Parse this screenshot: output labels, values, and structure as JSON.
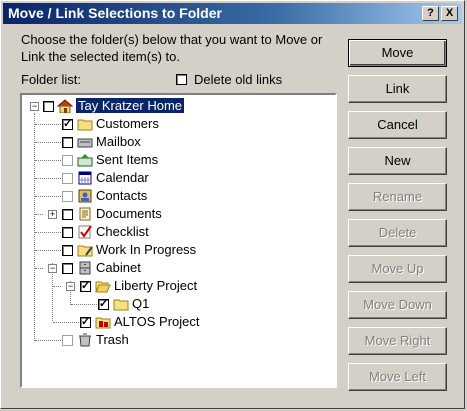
{
  "window": {
    "title": "Move / Link Selections to Folder",
    "help_glyph": "?",
    "close_glyph": "X"
  },
  "instructions": "Choose the folder(s) below that you want to Move or Link the selected item(s) to.",
  "folder_list_label": "Folder list:",
  "delete_old_links": {
    "label": "Delete old links",
    "checked": false
  },
  "tree": [
    {
      "label": "Tay Kratzer Home",
      "checked": false,
      "selected": true,
      "icon": "home-icon",
      "expander": "−"
    },
    {
      "label": "Customers",
      "checked": true,
      "icon": "folder-icon"
    },
    {
      "label": "Mailbox",
      "checked": false,
      "icon": "mailbox-icon"
    },
    {
      "label": "Sent Items",
      "checked": false,
      "icon": "sent-items-icon",
      "dim": true
    },
    {
      "label": "Calendar",
      "checked": false,
      "icon": "calendar-icon",
      "dim": true
    },
    {
      "label": "Contacts",
      "checked": false,
      "icon": "contacts-icon",
      "dim": true
    },
    {
      "label": "Documents",
      "checked": false,
      "icon": "documents-icon",
      "expander": "+"
    },
    {
      "label": "Checklist",
      "checked": false,
      "icon": "checklist-icon"
    },
    {
      "label": "Work In Progress",
      "checked": false,
      "icon": "work-in-progress-icon"
    },
    {
      "label": "Cabinet",
      "checked": false,
      "icon": "cabinet-icon",
      "expander": "−"
    },
    {
      "label": "Liberty Project",
      "checked": true,
      "icon": "open-folder-icon",
      "expander": "−"
    },
    {
      "label": "Q1",
      "checked": true,
      "icon": "folder-icon"
    },
    {
      "label": "ALTOS Project",
      "checked": true,
      "icon": "shared-folder-icon"
    },
    {
      "label": "Trash",
      "checked": false,
      "icon": "trash-icon",
      "dim": true
    }
  ],
  "buttons": [
    {
      "label": "Move",
      "enabled": true
    },
    {
      "label": "Link",
      "enabled": true
    },
    {
      "label": "Cancel",
      "enabled": true
    },
    {
      "label": "New",
      "enabled": true
    },
    {
      "label": "Rename",
      "enabled": false
    },
    {
      "label": "Delete",
      "enabled": false
    },
    {
      "label": "Move Up",
      "enabled": false
    },
    {
      "label": "Move Down",
      "enabled": false
    },
    {
      "label": "Move Right",
      "enabled": false
    },
    {
      "label": "Move Left",
      "enabled": false
    }
  ],
  "colors": {
    "titlebar": "#0a246a",
    "selection": "#0a246a",
    "face": "#d4d0c8"
  }
}
